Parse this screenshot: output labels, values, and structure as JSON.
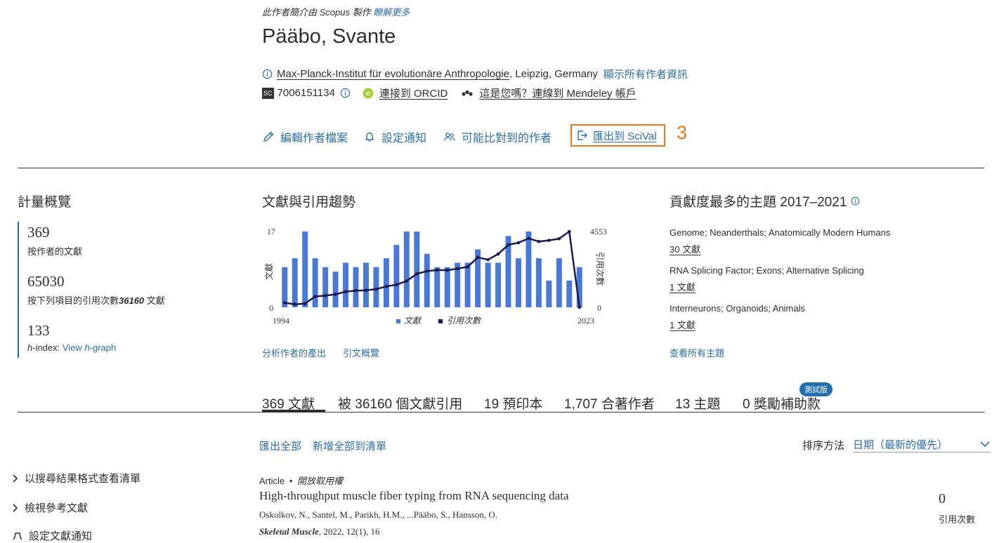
{
  "profile": {
    "scopus_note": "此作者簡介由 Scopus 製作",
    "learn_more": "瞭解更多",
    "name": "Pääbo, Svante",
    "affiliation_link": "Max-Planck-Institut für evolutionäre Anthropologie",
    "affiliation_rest": ", Leipzig, Germany",
    "show_all_info": "顯示所有作者資訊",
    "sc_badge": "SC",
    "scopus_id": "7006151134",
    "orcid_link": "連接到 ORCID",
    "mendeley_link": "這是您嗎？連線到 Mendeley 帳戶"
  },
  "actions": {
    "edit_profile": "編輯作者檔案",
    "set_alert": "設定通知",
    "potential_matches": "可能比對到的作者",
    "export_scival": "匯出到 SciVal",
    "annotation": "3"
  },
  "metrics": {
    "heading": "計量概覽",
    "documents_value": "369",
    "documents_label": "按作者的文獻",
    "citations_value": "65030",
    "citations_label_prefix": "按下列項目的引用次數",
    "citations_docs": "36160",
    "citations_label_suffix": " 文獻",
    "hindex_value": "133",
    "hindex_label": "h",
    "hindex_label_rest": "-index: ",
    "hindex_link": "View ",
    "hindex_link_h": "h",
    "hindex_link_rest": "-graph"
  },
  "trends": {
    "heading": "文獻與引用趨勢",
    "analyze_link": "分析作者的產出",
    "citation_overview_link": "引文概覽"
  },
  "chart_data": {
    "type": "bar",
    "x": [
      1994,
      1995,
      1996,
      1997,
      1998,
      1999,
      2000,
      2001,
      2002,
      2003,
      2004,
      2005,
      2006,
      2007,
      2008,
      2009,
      2010,
      2011,
      2012,
      2013,
      2014,
      2015,
      2016,
      2017,
      2018,
      2019,
      2020,
      2021,
      2022,
      2023
    ],
    "series": [
      {
        "name": "文獻",
        "kind": "bar",
        "axis": "left",
        "color": "#4a78d6",
        "values": [
          9,
          11,
          17,
          11,
          9,
          8,
          10,
          9,
          10,
          9,
          11,
          14,
          17,
          17,
          12,
          9,
          9,
          10,
          10,
          13,
          10,
          10,
          16,
          11,
          17,
          11,
          6,
          11,
          6,
          9
        ]
      },
      {
        "name": "引用次數",
        "kind": "line",
        "axis": "right",
        "color": "#1c1a4b",
        "values": [
          270,
          180,
          220,
          650,
          700,
          780,
          940,
          1000,
          1020,
          1090,
          1250,
          1360,
          1580,
          2010,
          2170,
          2240,
          2230,
          2320,
          2430,
          3000,
          2860,
          3200,
          3750,
          3880,
          4140,
          3950,
          4020,
          4120,
          4553,
          0
        ]
      }
    ],
    "yleft": {
      "label": "文獻",
      "min_label": "0",
      "max_label": "17",
      "range": [
        0,
        17
      ]
    },
    "yright": {
      "label": "引用次數",
      "min_label": "0",
      "max_label": "4553",
      "range": [
        0,
        4553
      ]
    },
    "xstart_label": "1994",
    "xend_label": "2023",
    "legend_position": "bottom"
  },
  "topics": {
    "heading": "貢獻度最多的主題 2017–2021",
    "items": [
      {
        "title": "Genome; Neanderthals; Anatomically Modern Humans",
        "count": "30 文獻"
      },
      {
        "title": "RNA Splicing Factor; Exons; Alternative Splicing",
        "count": "1 文獻"
      },
      {
        "title": "Interneurons; Organoids; Animals",
        "count": "1 文獻"
      }
    ],
    "view_all": "查看所有主題"
  },
  "tabs": {
    "documents": "369 文獻",
    "cited_by": "被 36160 個文獻引用",
    "preprints": "19 預印本",
    "coauthors": "1,707 合著作者",
    "topics": "13 主題",
    "grants": "0 獎勵補助款",
    "beta_badge": "測試版"
  },
  "sidebar": {
    "view_as_search": "以搜尋結果格式查看清單",
    "view_references": "檢視參考文獻",
    "set_alert": "設定文獻通知"
  },
  "doc_toolbar": {
    "export_all": "匯出全部",
    "add_all_list": "新增全部到清單",
    "sort_label": "排序方法",
    "sort_value": "日期（最新的優先）"
  },
  "document": {
    "type": "Article",
    "access": "開放取用權",
    "title": "High-throughput muscle fiber typing from RNA sequencing data",
    "authors": "Oskolkov, N., Santel, M., Parikh, H.M., ...Pääbo, S., Hansson, O.",
    "journal": "Skeletal Muscle",
    "citation": ", 2022, 12(1), 16",
    "cited_count": "0",
    "cited_label": "引用次數"
  }
}
